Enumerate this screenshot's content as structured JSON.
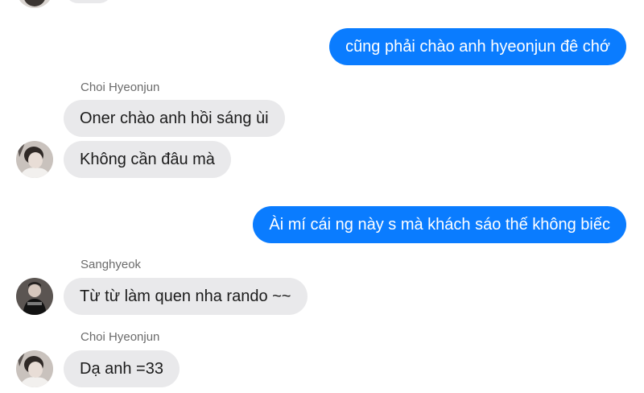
{
  "chat": {
    "messages": [
      {
        "id": "m1",
        "direction": "outgoing",
        "text": "cũng phải chào anh hyeonjun đê chớ"
      },
      {
        "id": "m2",
        "direction": "incoming",
        "sender": "Choi Hyeonjun",
        "text": "Oner chào anh hồi sáng ùi"
      },
      {
        "id": "m3",
        "direction": "incoming",
        "text": "Không cần đâu mà"
      },
      {
        "id": "m4",
        "direction": "outgoing",
        "text": "Ài mí cái ng này s mà khách sáo thế không biếc"
      },
      {
        "id": "m5",
        "direction": "incoming",
        "sender": "Sanghyeok",
        "text": "Từ từ làm quen nha rando ~~"
      },
      {
        "id": "m6",
        "direction": "incoming",
        "sender": "Choi Hyeonjun",
        "text": "Dạ anh =33"
      }
    ]
  },
  "colors": {
    "outgoing_bubble": "#0a7cff",
    "incoming_bubble": "#e9e9eb",
    "sender_name": "#6b6b6b"
  },
  "icons": {
    "avatar_choi": "avatar-choi-hyeonjun-icon",
    "avatar_sanghyeok": "avatar-sanghyeok-icon"
  }
}
